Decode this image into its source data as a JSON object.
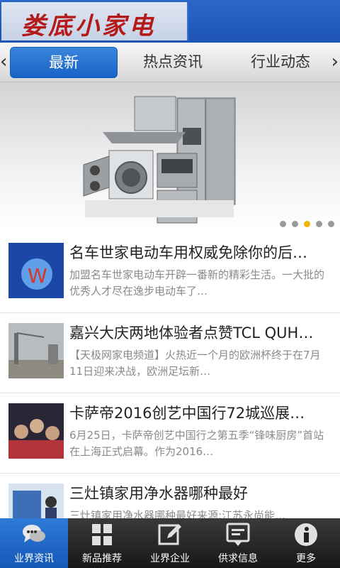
{
  "header": {
    "logo_text": "娄底小家电"
  },
  "tabs": {
    "items": [
      {
        "label": "最新",
        "active": true
      },
      {
        "label": "热点资讯",
        "active": false
      },
      {
        "label": "行业动态",
        "active": false
      }
    ]
  },
  "banner": {
    "slide_count": 5,
    "active_slide": 3
  },
  "news": [
    {
      "title": "名车世家电动车用权威免除你的后…",
      "summary": "加盟名车世家电动车开辟一番新的精彩生活。一大批的优秀人才尽在逸步电动车了…"
    },
    {
      "title": "嘉兴大庆两地体验者点赞TCL QUH…",
      "summary": "【天极网家电频道】火热近一个月的欧洲杯终于在7月11日迎来决战，欧洲足坛新…"
    },
    {
      "title": "卡萨帝2016创艺中国行72城巡展…",
      "summary": "6月25日，卡萨帝创艺中国行之第五季“锋味厨房”首站在上海正式启幕。作为2016…"
    },
    {
      "title": "三灶镇家用净水器哪种最好",
      "summary": "三灶镇家用净水器哪种最好来源:江苏永尚能…"
    }
  ],
  "bottom_nav": [
    {
      "label": "业界资讯",
      "icon": "chat-bubbles-icon",
      "active": true
    },
    {
      "label": "新品推荐",
      "icon": "grid-icon",
      "active": false
    },
    {
      "label": "业界企业",
      "icon": "edit-icon",
      "active": false
    },
    {
      "label": "供求信息",
      "icon": "message-icon",
      "active": false
    },
    {
      "label": "更多",
      "icon": "info-icon",
      "active": false
    }
  ]
}
